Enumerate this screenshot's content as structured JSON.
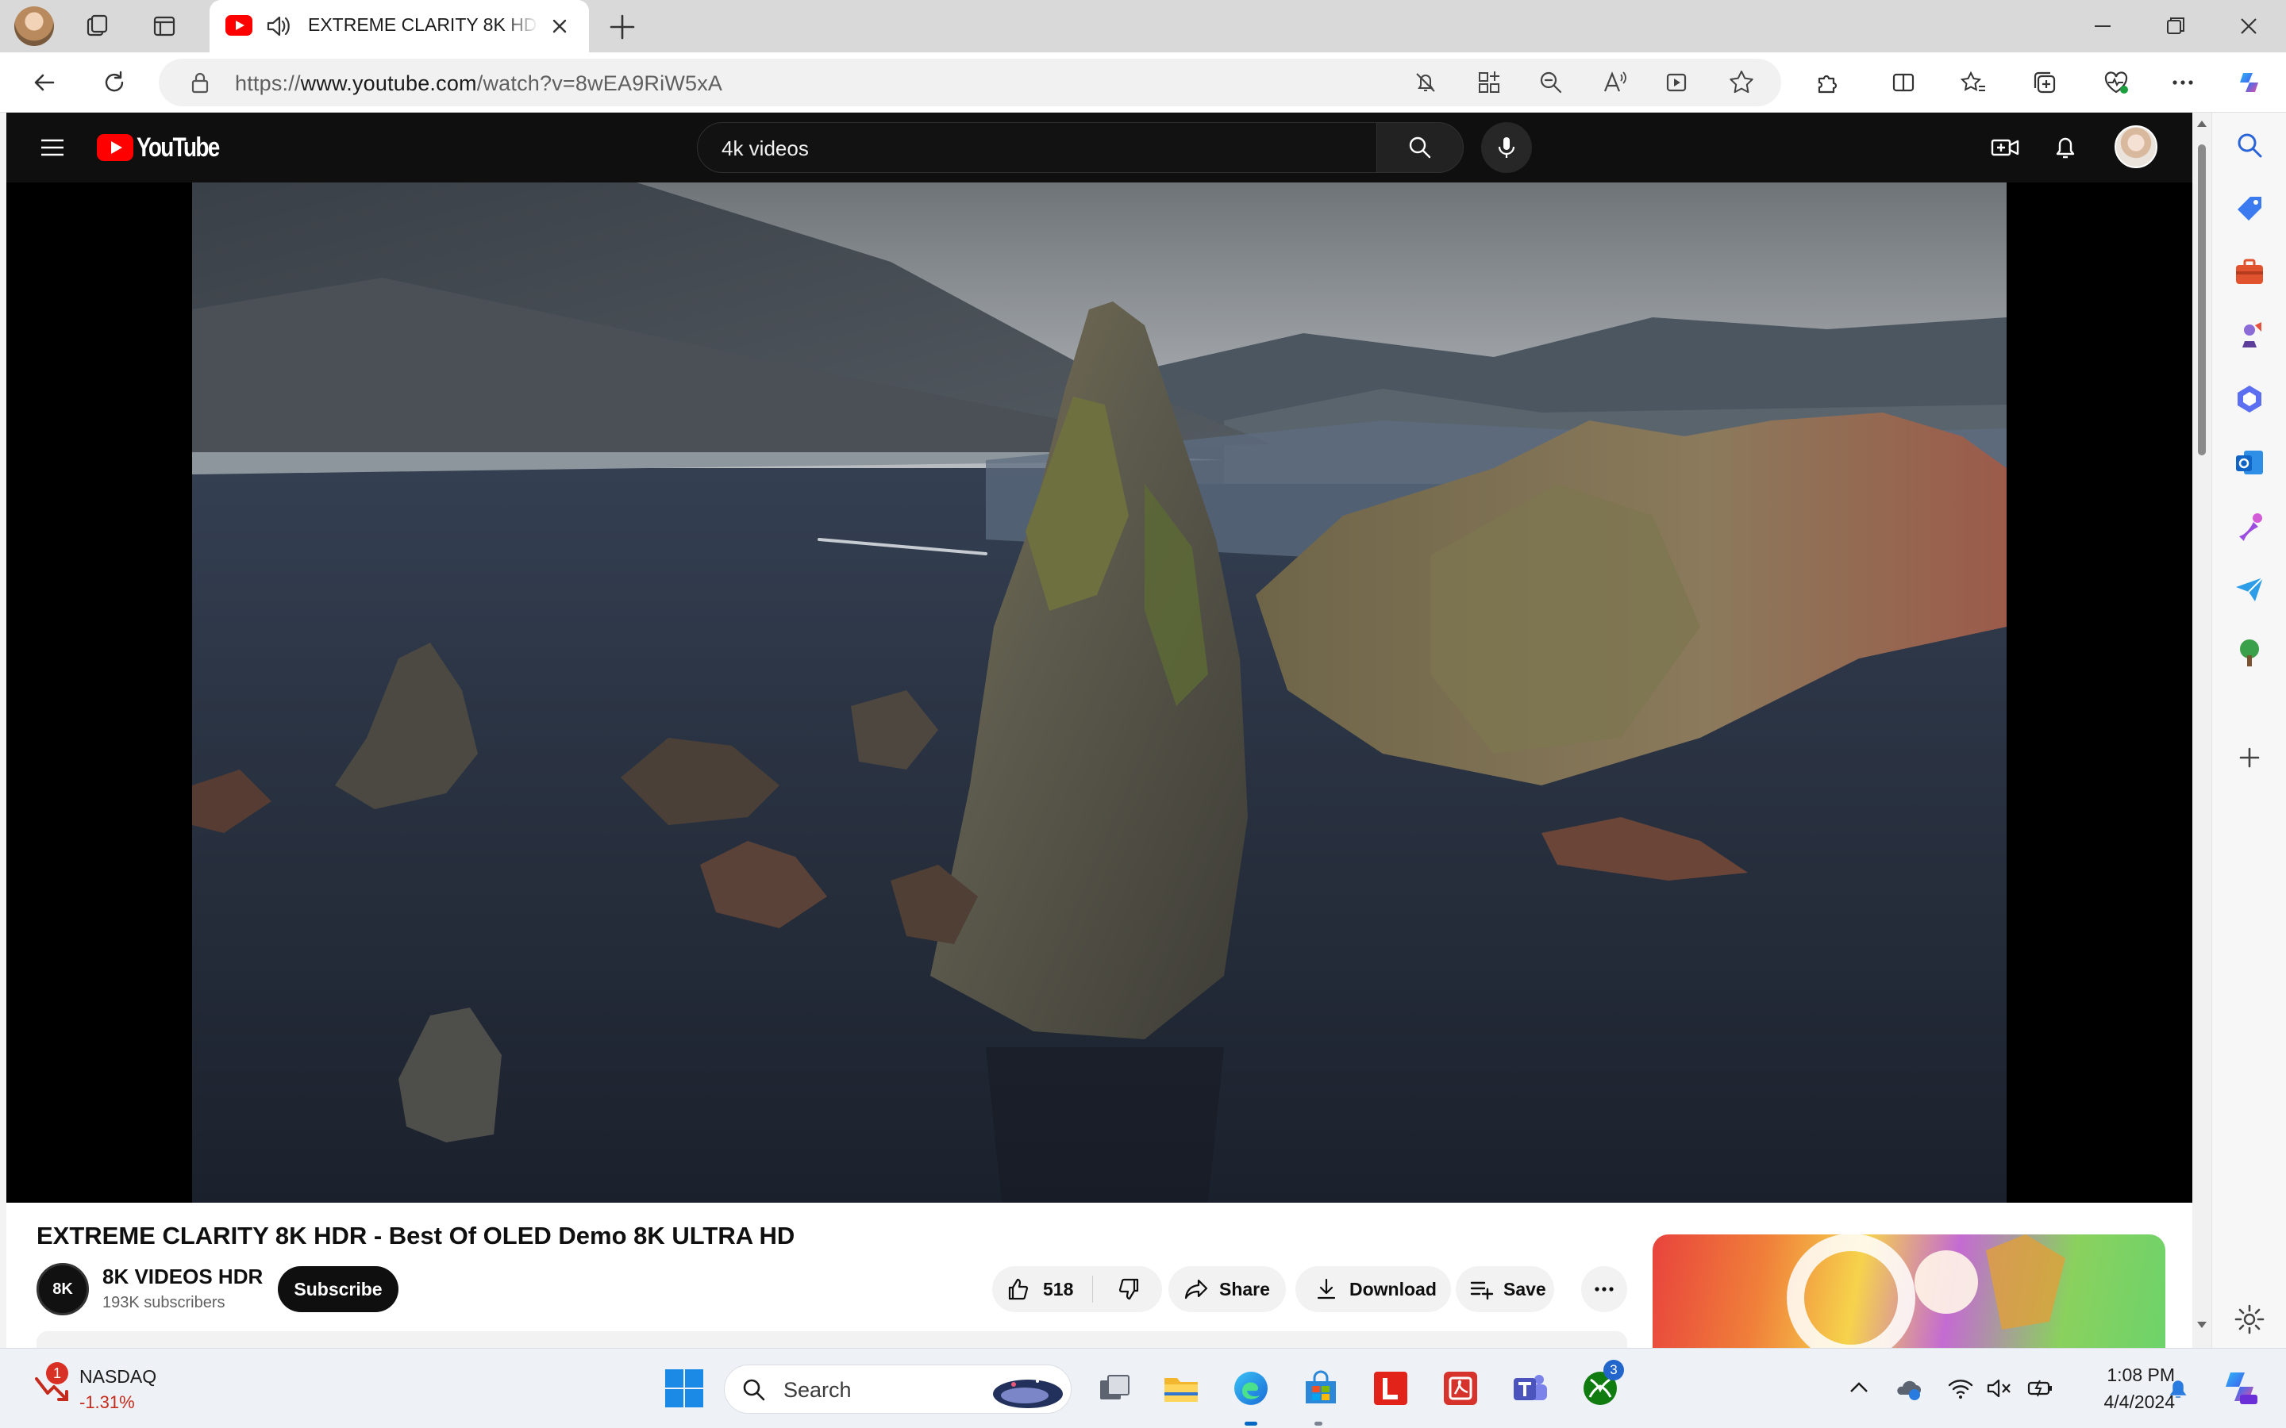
{
  "browser": {
    "tab": {
      "title": "EXTREME CLARITY 8K HDR - Best Of OLED Demo 8K ULTRA HD"
    },
    "address_bar": {
      "url_prefix": "https://",
      "url_host": "www.youtube.com",
      "url_path": "/watch?v=8wEA9RiW5xA"
    }
  },
  "youtube": {
    "logo_text": "YouTube",
    "search": {
      "value": "4k videos"
    },
    "video": {
      "title": "EXTREME CLARITY 8K HDR - Best Of OLED Demo 8K ULTRA HD",
      "channel_name": "8K VIDEOS HDR",
      "channel_avatar_text": "8K",
      "subscribers": "193K subscribers",
      "subscribe_label": "Subscribe",
      "likes": "518",
      "share_label": "Share",
      "download_label": "Download",
      "save_label": "Save"
    }
  },
  "taskbar": {
    "stock": {
      "name": "NASDAQ",
      "change": "-1.31%",
      "badge": "1"
    },
    "search_label": "Search",
    "xbox_badge": "3",
    "clock": {
      "time": "1:08 PM",
      "date": "4/4/2024"
    }
  },
  "colors": {
    "youtube_red": "#ff0000",
    "header_bg": "#0f0f0f",
    "taskbar_bg": "#eef1f6",
    "accent": "#0067c0"
  }
}
